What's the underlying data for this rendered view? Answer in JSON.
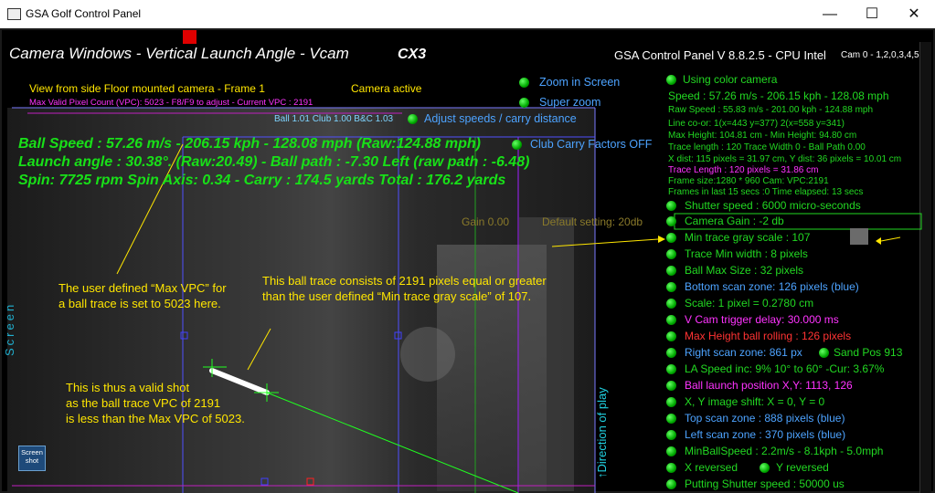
{
  "window": {
    "title": "GSA Golf Control Panel",
    "minimize": "—",
    "maximize": "☐",
    "close": "✕"
  },
  "header": {
    "camera_title": "Camera Windows - Vertical Launch Angle - Vcam",
    "cx3": "CX3",
    "version": "GSA Control Panel V 8.8.2.5 - CPU Intel",
    "cam_list": "Cam 0 - 1,2,0,3,4,5"
  },
  "camera_panel": {
    "view_label": "View from side Floor mounted camera -  Frame 1",
    "camera_active": "Camera active",
    "max_vpc": "Max Valid Pixel Count (VPC): 5023  - F8/F9 to adjust - Current VPC : 2191",
    "ball_club": "Ball 1.01 Club 1.00 B&C 1.03",
    "adjust_speeds": "Adjust speeds / carry distance",
    "club_carry": "Club Carry Factors OFF",
    "ball_speed": "Ball Speed : 57.26 m/s - 206.15 kph - 128.08 mph (Raw:124.88 mph)",
    "launch_angle": "Launch angle : 30.38°. (Raw:20.49) - Ball path : -7.30 Left (raw path : -6.48)",
    "spin": "Spin: 7725 rpm  Spin Axis: 0.34 - Carry : 174.5 yards  Total : 176.2 yards",
    "gain": "Gain 0.00",
    "default_setting": "Default setting: 20db",
    "annotation_max_vpc": "The user defined “Max VPC” for\na ball trace is set to 5023 here.",
    "annotation_trace": "This ball trace consists of 2191 pixels equal or greater\nthan the user defined “Min trace gray scale” of 107.",
    "annotation_valid": "This is thus a valid shot\nas the ball trace VPC of 2191\nis less than the Max VPC of 5023.",
    "screen_label": "Screen",
    "direction_label": "↑Direction of play",
    "screenshot_btn": "Screen\nshot"
  },
  "right_menu": {
    "zoom_in": "Zoom in Screen",
    "super_zoom": "Super zoom",
    "using_color": "Using color camera",
    "speed": "Speed : 57.26 m/s - 206.15 kph - 128.08 mph",
    "raw_speed": "Raw Speed : 55.83 m/s - 201.00 kph - 124.88 mph",
    "line_coor": "Line co-or: 1(x=443 y=377) 2(x=558 y=341)",
    "max_height": "Max Height: 104.81 cm - Min Height: 94.80 cm",
    "trace_length": "Trace length : 120 Trace Width 0 - Ball Path 0.00",
    "xdist": "X dist: 115 pixels = 31.97 cm, Y dist: 36 pixels = 10.01 cm",
    "trace_length_cm": "Trace Length : 120 pixels = 31.86 cm",
    "frame_size": "Frame size:1280 * 960 Cam:  VPC:2191",
    "frames_last": "Frames in last 15 secs :0 Time elapsed:  13 secs",
    "shutter": "Shutter speed : 6000 micro-seconds",
    "camera_gain": "Camera Gain : -2 db",
    "min_trace": "Min trace gray scale : 107",
    "trace_min_width": "Trace Min width : 8 pixels",
    "ball_max": "Ball Max Size : 32 pixels",
    "bottom_scan": "Bottom scan zone: 126 pixels (blue)",
    "scale": "Scale: 1 pixel = 0.2780 cm",
    "vcam_trigger": "V Cam trigger delay: 30.000 ms",
    "max_height_roll": "Max Height ball rolling : 126 pixels",
    "right_scan": "Right scan zone: 861 px",
    "sand_pos": "Sand Pos 913",
    "la_speed": "LA Speed inc: 9% 10° to 60° -Cur: 3.67%",
    "ball_launch": "Ball launch position X,Y: 1113, 126",
    "xy_shift": "X, Y image shift: X = 0, Y = 0",
    "top_scan": "Top scan zone : 888 pixels (blue)",
    "left_scan": "Left scan zone : 370 pixels (blue)",
    "min_ball_speed": "MinBallSpeed : 2.2m/s - 8.1kph - 5.0mph",
    "x_reversed": "X reversed",
    "y_reversed": "Y reversed",
    "putting": "Putting Shutter speed : 50000 us"
  },
  "colors": {
    "green_text": "#18e018",
    "yellow_text": "#ffe600",
    "magenta_text": "#ff33ff",
    "blue_text": "#4da3ff",
    "red_text": "#ff3333",
    "right_green": "#22d822"
  }
}
